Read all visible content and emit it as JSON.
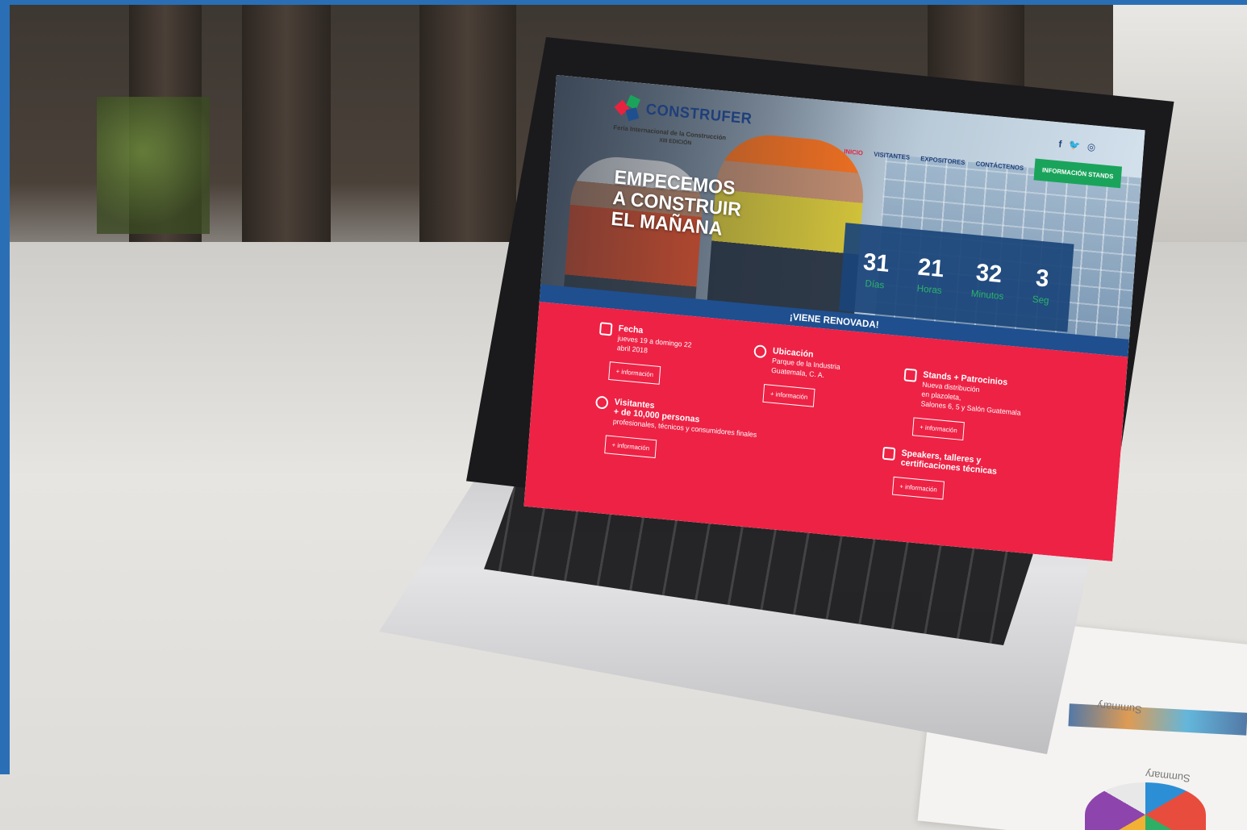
{
  "site": {
    "brand": "CONSTRUFER",
    "subtitle": "Feria Internacional de la Construcción",
    "edition": "XIII EDICIÓN",
    "social": [
      "f",
      "🐦",
      "◎"
    ],
    "nav": [
      {
        "label": "INICIO",
        "active": true
      },
      {
        "label": "VISITANTES",
        "active": false
      },
      {
        "label": "EXPOSITORES",
        "active": false
      },
      {
        "label": "CONTÁCTENOS",
        "active": false
      }
    ],
    "cta": "INFORMACIÓN STANDS",
    "hero": {
      "line1": "EMPECEMOS",
      "line2": "A CONSTRUIR",
      "line3": "EL MAÑANA"
    },
    "countdown": [
      {
        "value": "31",
        "label": "Días"
      },
      {
        "value": "21",
        "label": "Horas"
      },
      {
        "value": "32",
        "label": "Minutos"
      },
      {
        "value": "3",
        "label": "Seg"
      }
    ],
    "banner": "¡VIENE RENOVADA!",
    "info": {
      "fecha": {
        "title": "Fecha",
        "line1": "jueves 19 a domingo 22",
        "line2": "abril 2018",
        "button": "+ información"
      },
      "ubicacion": {
        "title": "Ubicación",
        "line1": "Parque de la Industria",
        "line2": "Guatemala, C. A.",
        "button": "+ información"
      },
      "stands": {
        "title": "Stands + Patrocinios",
        "line1": "Nueva distribución",
        "line2": "en plazoleta,",
        "line3": "Salones 6, 5 y Salón Guatemala",
        "button": "+ información"
      },
      "visitantes": {
        "title": "Visitantes",
        "line1": "+ de 10,000 personas",
        "line2": "profesionales, técnicos y consumidores finales",
        "button": "+ información"
      },
      "speakers": {
        "title": "Speakers, talleres y",
        "line1": "certificaciones técnicas",
        "button": "+ información"
      }
    }
  },
  "desk_paper": {
    "label1": "Summary",
    "label2": "Summary"
  },
  "colors": {
    "brand_blue": "#1f3f7a",
    "brand_red": "#ee2245",
    "brand_green": "#1aa45b",
    "countdown_bg": "#1a447a"
  }
}
